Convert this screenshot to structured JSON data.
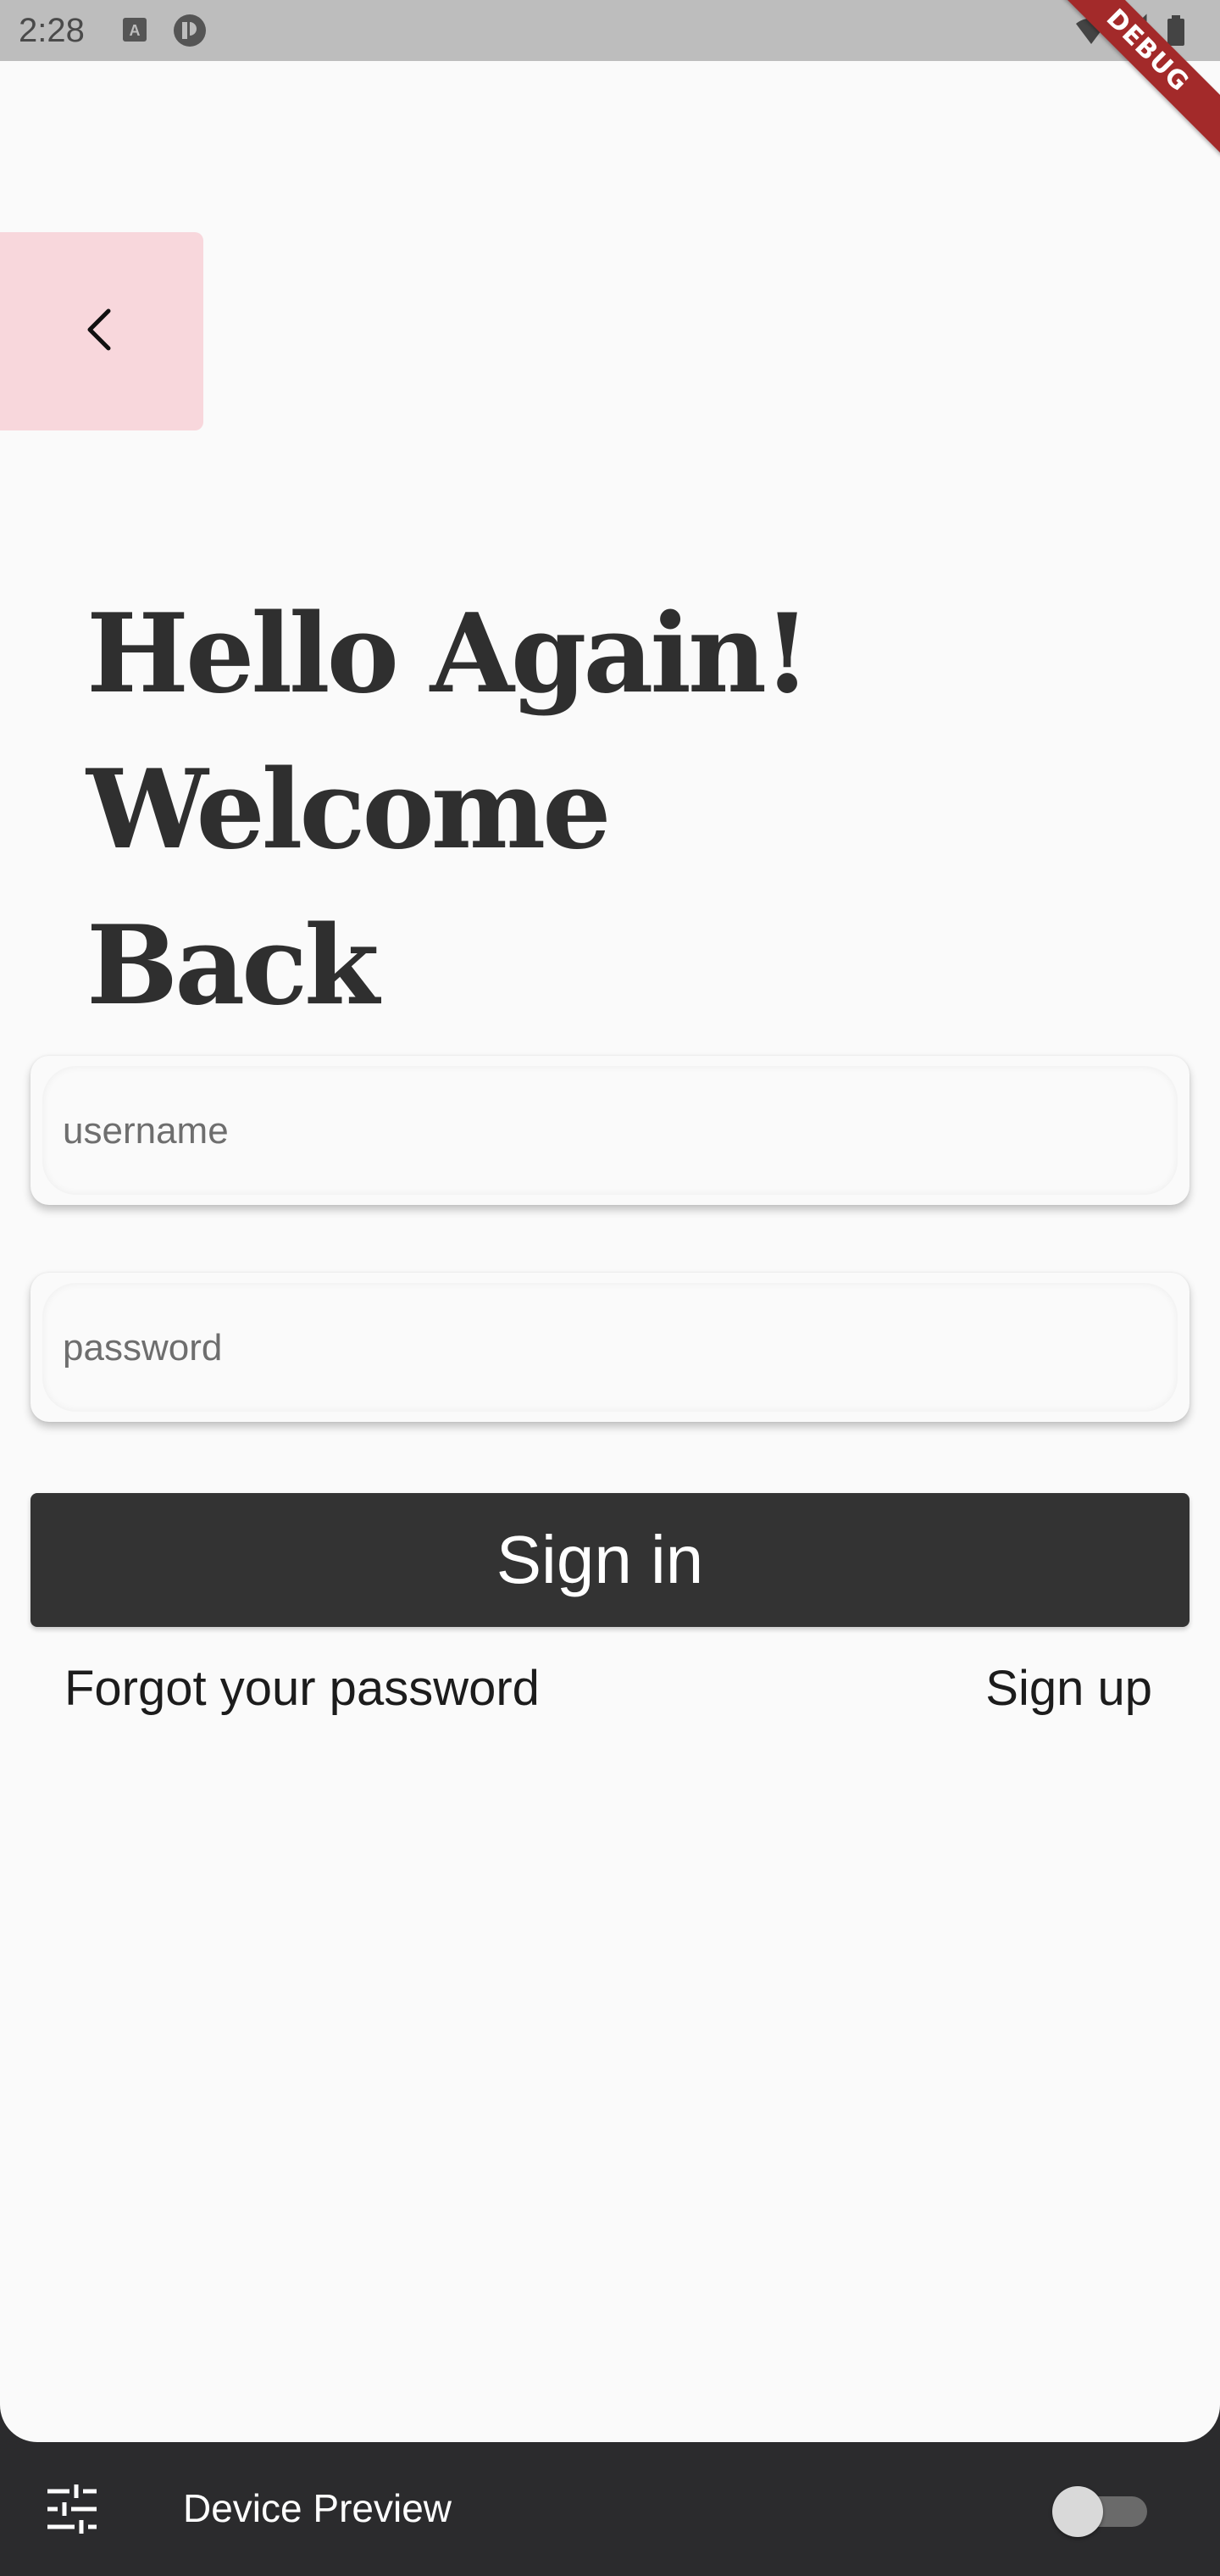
{
  "status_bar": {
    "time": "2:28",
    "icons": [
      "text-a-icon",
      "app-circle-icon",
      "wifi-icon",
      "signal-icon",
      "battery-icon"
    ]
  },
  "debug_banner": {
    "label": "DEBUG",
    "color": "#a32a2a"
  },
  "back_button": {
    "icon": "chevron-left-icon",
    "background": "#f8d7dc"
  },
  "heading": {
    "line1": "Hello Again!",
    "line2": "Welcome",
    "line3": "Back"
  },
  "form": {
    "username": {
      "value": "",
      "placeholder": "username"
    },
    "password": {
      "value": "",
      "placeholder": "password"
    },
    "signin_label": "Sign in",
    "forgot_label": "Forgot your password",
    "signup_label": "Sign up"
  },
  "device_preview": {
    "settings_icon": "tune-icon",
    "title": "Device Preview",
    "toggle_on": false
  },
  "colors": {
    "page_background": "#fafafa",
    "primary_dark": "#333333",
    "accent_pink": "#f8d7dc",
    "preview_bar": "#2b2b2d"
  }
}
